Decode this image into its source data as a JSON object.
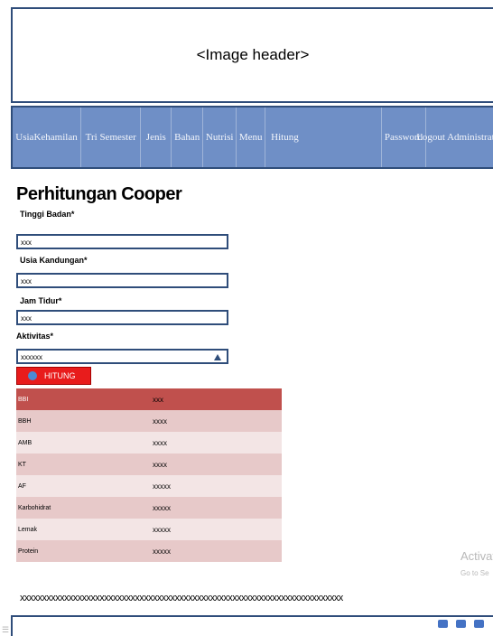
{
  "header": {
    "placeholder": "<Image header>"
  },
  "nav": {
    "items": [
      "UsiaKehamilan",
      "Tri Semester",
      "Jenis",
      "Bahan",
      "Nutrisi",
      "Menu",
      "Hitung",
      "Password",
      "Logout Administrator"
    ]
  },
  "page": {
    "title": "Perhitungan Cooper"
  },
  "form": {
    "tinggi_badan": {
      "label": "Tinggi Badan*",
      "value": "xxx"
    },
    "usia_kandungan": {
      "label": "Usia Kandungan*",
      "value": "xxx"
    },
    "jam_tidur": {
      "label": "Jam Tidur*",
      "value": "xxx"
    },
    "aktivitas": {
      "label": "Aktivitas*",
      "value": "xxxxxx"
    },
    "submit_label": "HITUNG"
  },
  "results": [
    {
      "label": "BBI",
      "value": "xxx"
    },
    {
      "label": "BBH",
      "value": "xxxx"
    },
    {
      "label": "AMB",
      "value": "xxxx"
    },
    {
      "label": "KT",
      "value": "xxxx"
    },
    {
      "label": "AF",
      "value": "xxxxx"
    },
    {
      "label": "Karbohidrat",
      "value": "xxxxx"
    },
    {
      "label": "Lemak",
      "value": "xxxxx"
    },
    {
      "label": "Protein",
      "value": "xxxxx"
    }
  ],
  "watermark": {
    "line1": "Activat",
    "line2": "Go to Se"
  },
  "footer": {
    "text": "xxxxxxxxxxxxxxxxxxxxxxxxxxxxxxxxxxxxxxxxxxxxxxxxxxxxxxxxxxxxxxxxxxxxxxxxx"
  },
  "colors": {
    "nav_bg": "#6f8fc6",
    "border": "#2f4d7a",
    "button": "#e81c1c",
    "table_head": "#c0504d"
  }
}
